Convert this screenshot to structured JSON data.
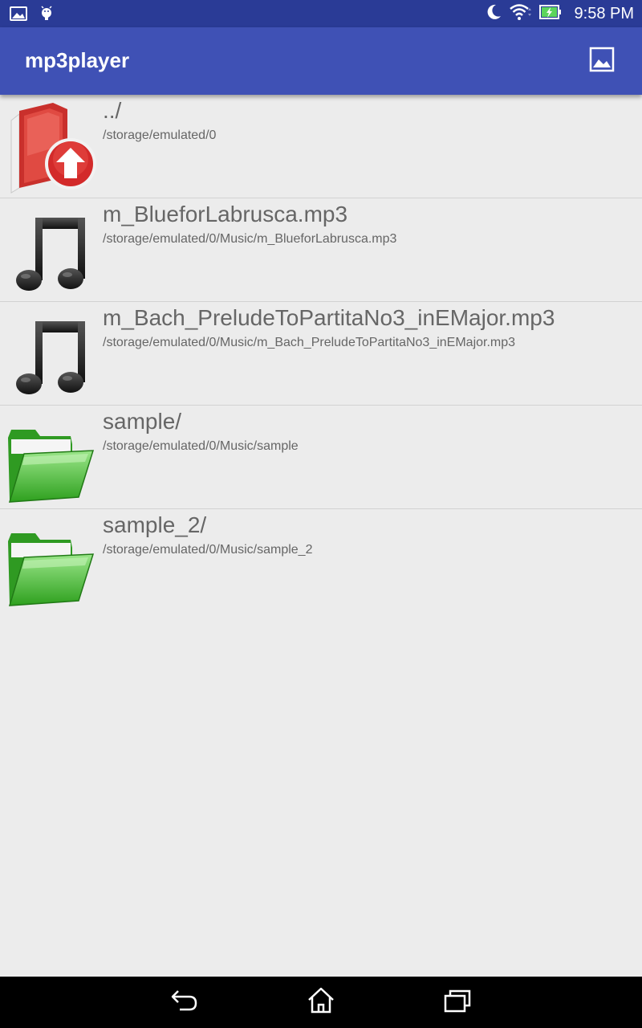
{
  "status_bar": {
    "time": "9:58 PM",
    "icons": [
      "image-notification-icon",
      "android-debug-icon",
      "moon-icon",
      "wifi-icon",
      "battery-charging-icon"
    ]
  },
  "app_bar": {
    "title": "mp3player",
    "action_icon": "image-icon"
  },
  "files": [
    {
      "name": "../",
      "path": "/storage/emulated/0",
      "icon": "parent-folder-up-icon"
    },
    {
      "name": "m_BlueforLabrusca.mp3",
      "path": "/storage/emulated/0/Music/m_BlueforLabrusca.mp3",
      "icon": "music-note-icon"
    },
    {
      "name": "m_Bach_PreludeToPartitaNo3_inEMajor.mp3",
      "path": "/storage/emulated/0/Music/m_Bach_PreludeToPartitaNo3_inEMajor.mp3",
      "icon": "music-note-icon"
    },
    {
      "name": "sample/",
      "path": "/storage/emulated/0/Music/sample",
      "icon": "folder-icon"
    },
    {
      "name": "sample_2/",
      "path": "/storage/emulated/0/Music/sample_2",
      "icon": "folder-icon"
    }
  ],
  "colors": {
    "status_bar": "#2a3b96",
    "app_bar": "#3f51b5",
    "background": "#ececec",
    "folder_green": "#3cb52a",
    "parent_folder_red": "#d93a33"
  },
  "nav_bar": {
    "icons": [
      "back-icon",
      "home-icon",
      "recent-apps-icon"
    ]
  }
}
